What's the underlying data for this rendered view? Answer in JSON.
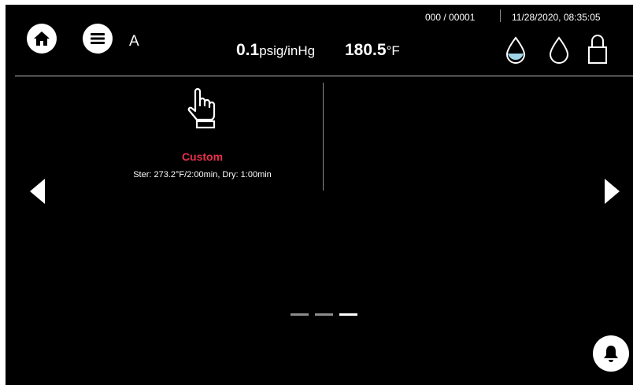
{
  "header": {
    "user_letter": "A",
    "pressure_value": "0.1",
    "pressure_unit": "psig/inHg",
    "temperature_value": "180.5",
    "temperature_unit": "°F",
    "cycle_counter": "000 / 00001",
    "datetime": "11/28/2020, 08:35:05",
    "icons": [
      "home-icon",
      "menu-icon",
      "water-level-icon",
      "drop-icon",
      "lock-icon"
    ]
  },
  "program": {
    "name": "Custom",
    "details": "Ster: 273.2°F/2:00min, Dry: 1:00min",
    "icon": "hand-pointer-icon",
    "name_color": "#e8304a"
  },
  "pagination": {
    "pages": 3,
    "active_page": 3
  },
  "footer": {
    "icon": "bell-icon"
  }
}
